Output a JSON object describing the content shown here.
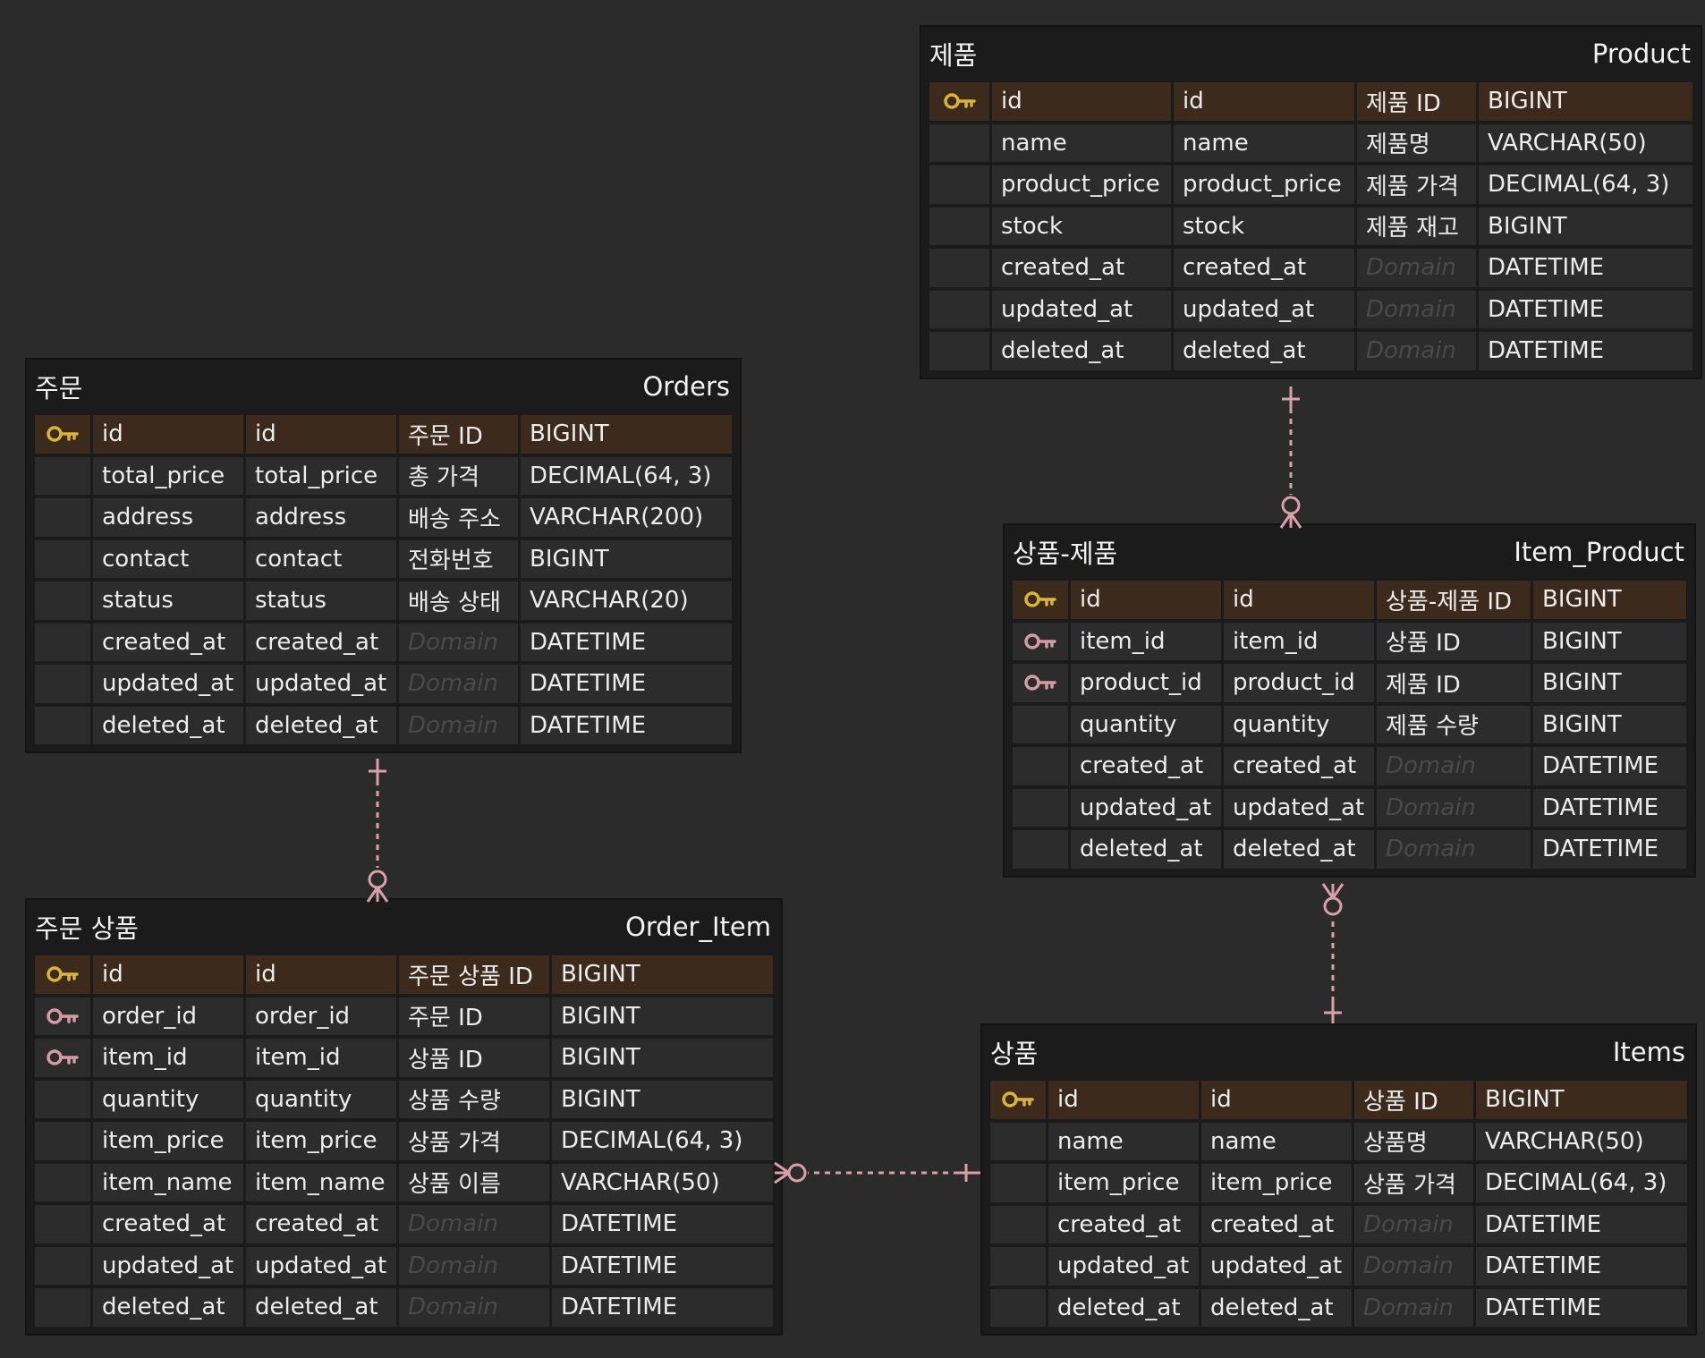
{
  "colors": {
    "background": "#2b2b2b",
    "pk_key": "#d9b43a",
    "fk_key": "#d49aa6",
    "relation_line": "#d9a0aa"
  },
  "entities": [
    {
      "id": "product",
      "logical_name": "제품",
      "physical_name": "Product",
      "rows": [
        {
          "key": "pk",
          "logical": "id",
          "physical": "id",
          "domain": "제품 ID",
          "type": "BIGINT"
        },
        {
          "key": "",
          "logical": "name",
          "physical": "name",
          "domain": "제품명",
          "type": "VARCHAR(50)"
        },
        {
          "key": "",
          "logical": "product_price",
          "physical": "product_price",
          "domain": "제품 가격",
          "type": "DECIMAL(64, 3)"
        },
        {
          "key": "",
          "logical": "stock",
          "physical": "stock",
          "domain": "제품 재고",
          "type": "BIGINT"
        },
        {
          "key": "",
          "logical": "created_at",
          "physical": "created_at",
          "domain": "Domain",
          "domain_placeholder": true,
          "type": "DATETIME"
        },
        {
          "key": "",
          "logical": "updated_at",
          "physical": "updated_at",
          "domain": "Domain",
          "domain_placeholder": true,
          "type": "DATETIME"
        },
        {
          "key": "",
          "logical": "deleted_at",
          "physical": "deleted_at",
          "domain": "Domain",
          "domain_placeholder": true,
          "type": "DATETIME"
        }
      ]
    },
    {
      "id": "orders",
      "logical_name": "주문",
      "physical_name": "Orders",
      "rows": [
        {
          "key": "pk",
          "logical": "id",
          "physical": "id",
          "domain": "주문 ID",
          "type": "BIGINT"
        },
        {
          "key": "",
          "logical": "total_price",
          "physical": "total_price",
          "domain": "총 가격",
          "type": "DECIMAL(64, 3)"
        },
        {
          "key": "",
          "logical": "address",
          "physical": "address",
          "domain": "배송 주소",
          "type": "VARCHAR(200)"
        },
        {
          "key": "",
          "logical": "contact",
          "physical": "contact",
          "domain": "전화번호",
          "type": "BIGINT"
        },
        {
          "key": "",
          "logical": "status",
          "physical": "status",
          "domain": "배송 상태",
          "type": "VARCHAR(20)"
        },
        {
          "key": "",
          "logical": "created_at",
          "physical": "created_at",
          "domain": "Domain",
          "domain_placeholder": true,
          "type": "DATETIME"
        },
        {
          "key": "",
          "logical": "updated_at",
          "physical": "updated_at",
          "domain": "Domain",
          "domain_placeholder": true,
          "type": "DATETIME"
        },
        {
          "key": "",
          "logical": "deleted_at",
          "physical": "deleted_at",
          "domain": "Domain",
          "domain_placeholder": true,
          "type": "DATETIME"
        }
      ]
    },
    {
      "id": "item-product",
      "logical_name": "상품-제품",
      "physical_name": "Item_Product",
      "rows": [
        {
          "key": "pk",
          "logical": "id",
          "physical": "id",
          "domain": "상품-제품 ID",
          "type": "BIGINT"
        },
        {
          "key": "fk",
          "logical": "item_id",
          "physical": "item_id",
          "domain": "상품 ID",
          "type": "BIGINT"
        },
        {
          "key": "fk",
          "logical": "product_id",
          "physical": "product_id",
          "domain": "제품 ID",
          "type": "BIGINT"
        },
        {
          "key": "",
          "logical": "quantity",
          "physical": "quantity",
          "domain": "제품 수량",
          "type": "BIGINT"
        },
        {
          "key": "",
          "logical": "created_at",
          "physical": "created_at",
          "domain": "Domain",
          "domain_placeholder": true,
          "type": "DATETIME"
        },
        {
          "key": "",
          "logical": "updated_at",
          "physical": "updated_at",
          "domain": "Domain",
          "domain_placeholder": true,
          "type": "DATETIME"
        },
        {
          "key": "",
          "logical": "deleted_at",
          "physical": "deleted_at",
          "domain": "Domain",
          "domain_placeholder": true,
          "type": "DATETIME"
        }
      ]
    },
    {
      "id": "order-item",
      "logical_name": "주문 상품",
      "physical_name": "Order_Item",
      "rows": [
        {
          "key": "pk",
          "logical": "id",
          "physical": "id",
          "domain": "주문 상품 ID",
          "type": "BIGINT"
        },
        {
          "key": "fk",
          "logical": "order_id",
          "physical": "order_id",
          "domain": "주문 ID",
          "type": "BIGINT"
        },
        {
          "key": "fk",
          "logical": "item_id",
          "physical": "item_id",
          "domain": "상품 ID",
          "type": "BIGINT"
        },
        {
          "key": "",
          "logical": "quantity",
          "physical": "quantity",
          "domain": "상품 수량",
          "type": "BIGINT"
        },
        {
          "key": "",
          "logical": "item_price",
          "physical": "item_price",
          "domain": "상품 가격",
          "type": "DECIMAL(64, 3)"
        },
        {
          "key": "",
          "logical": "item_name",
          "physical": "item_name",
          "domain": "상품 이름",
          "type": "VARCHAR(50)"
        },
        {
          "key": "",
          "logical": "created_at",
          "physical": "created_at",
          "domain": "Domain",
          "domain_placeholder": true,
          "type": "DATETIME"
        },
        {
          "key": "",
          "logical": "updated_at",
          "physical": "updated_at",
          "domain": "Domain",
          "domain_placeholder": true,
          "type": "DATETIME"
        },
        {
          "key": "",
          "logical": "deleted_at",
          "physical": "deleted_at",
          "domain": "Domain",
          "domain_placeholder": true,
          "type": "DATETIME"
        }
      ]
    },
    {
      "id": "items",
      "logical_name": "상품",
      "physical_name": "Items",
      "rows": [
        {
          "key": "pk",
          "logical": "id",
          "physical": "id",
          "domain": "상품 ID",
          "type": "BIGINT"
        },
        {
          "key": "",
          "logical": "name",
          "physical": "name",
          "domain": "상품명",
          "type": "VARCHAR(50)"
        },
        {
          "key": "",
          "logical": "item_price",
          "physical": "item_price",
          "domain": "상품 가격",
          "type": "DECIMAL(64, 3)"
        },
        {
          "key": "",
          "logical": "created_at",
          "physical": "created_at",
          "domain": "Domain",
          "domain_placeholder": true,
          "type": "DATETIME"
        },
        {
          "key": "",
          "logical": "updated_at",
          "physical": "updated_at",
          "domain": "Domain",
          "domain_placeholder": true,
          "type": "DATETIME"
        },
        {
          "key": "",
          "logical": "deleted_at",
          "physical": "deleted_at",
          "domain": "Domain",
          "domain_placeholder": true,
          "type": "DATETIME"
        }
      ]
    }
  ],
  "relationships": [
    {
      "from": "product",
      "to": "item-product",
      "from_cardinality": "one",
      "to_cardinality": "zero-or-many"
    },
    {
      "from": "orders",
      "to": "order-item",
      "from_cardinality": "one",
      "to_cardinality": "zero-or-many"
    },
    {
      "from": "items",
      "to": "item-product",
      "from_cardinality": "one",
      "to_cardinality": "zero-or-many"
    },
    {
      "from": "items",
      "to": "order-item",
      "from_cardinality": "one",
      "to_cardinality": "zero-or-many"
    }
  ]
}
